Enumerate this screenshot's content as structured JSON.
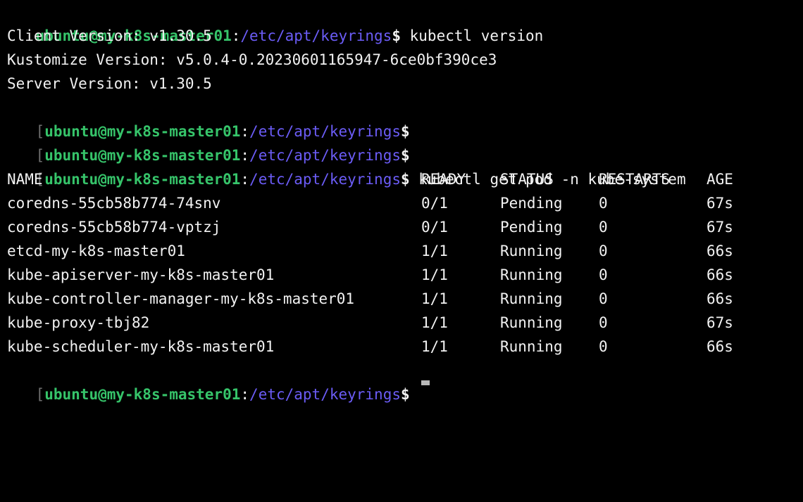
{
  "colors": {
    "background": "#000000",
    "text": "#f2f2f2",
    "user_host": "#36c46a",
    "path": "#6b5cf6",
    "bracket": "#6f6f6f"
  },
  "prompt": {
    "bracket": "[",
    "user_host": "ubuntu@my-k8s-master01",
    "colon": ":",
    "path": "/etc/apt/keyrings",
    "dollar": "$"
  },
  "commands": {
    "first": "kubectl version",
    "second": "kubectl get pod -n kube-system"
  },
  "version_output": {
    "client": "Client Version: v1.30.5",
    "kustomize": "Kustomize Version: v5.0.4-0.20230601165947-6ce0bf390ce3",
    "server": "Server Version: v1.30.5"
  },
  "pods_table": {
    "headers": [
      "NAME",
      "READY",
      "STATUS",
      "RESTARTS",
      "AGE"
    ],
    "rows": [
      [
        "coredns-55cb58b774-74snv",
        "0/1",
        "Pending",
        "0",
        "67s"
      ],
      [
        "coredns-55cb58b774-vptzj",
        "0/1",
        "Pending",
        "0",
        "67s"
      ],
      [
        "etcd-my-k8s-master01",
        "1/1",
        "Running",
        "0",
        "66s"
      ],
      [
        "kube-apiserver-my-k8s-master01",
        "1/1",
        "Running",
        "0",
        "66s"
      ],
      [
        "kube-controller-manager-my-k8s-master01",
        "1/1",
        "Running",
        "0",
        "66s"
      ],
      [
        "kube-proxy-tbj82",
        "1/1",
        "Running",
        "0",
        "67s"
      ],
      [
        "kube-scheduler-my-k8s-master01",
        "1/1",
        "Running",
        "0",
        "66s"
      ]
    ]
  }
}
